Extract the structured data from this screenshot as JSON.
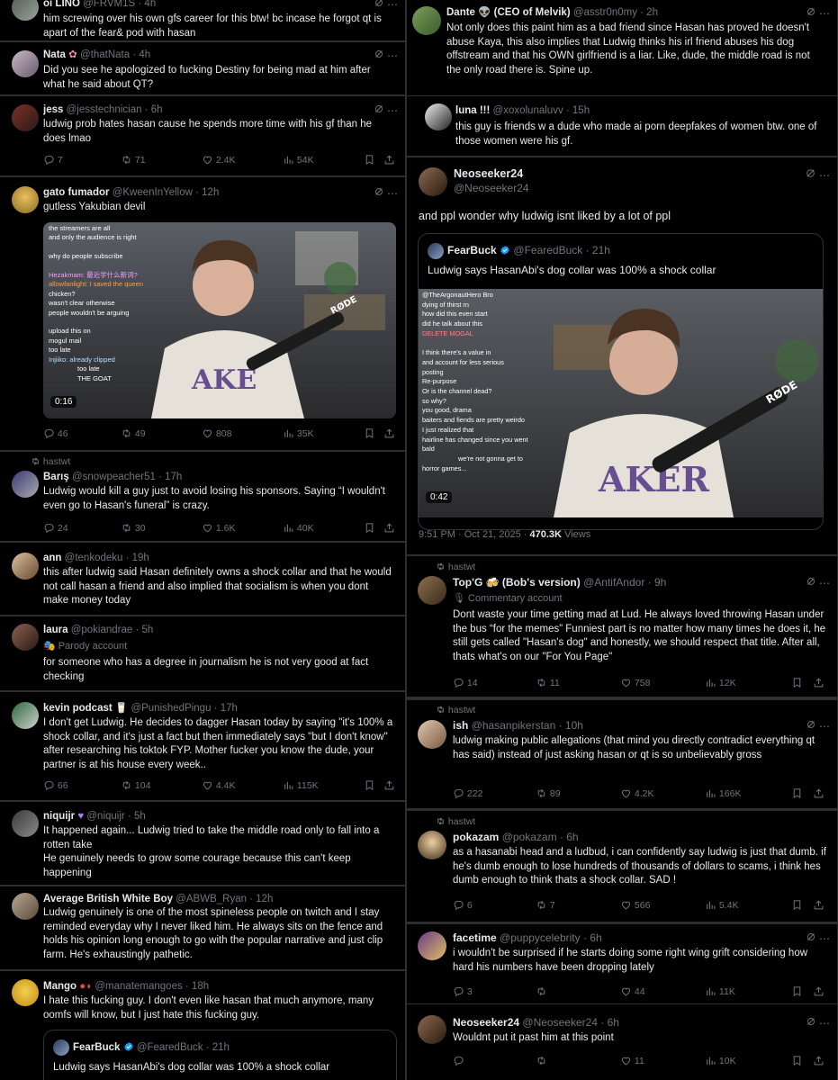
{
  "colors": {
    "accent": "#1d9bf0",
    "verified_gold": "#e2b719",
    "muted": "#71767b"
  },
  "left": {
    "p1": {
      "name": "oi LINO",
      "handle": "@FRVM1S · 4h",
      "body": "him screwing over his own gfs career for this btw! bc incase he forgot qt is apart of the fear& pod with hasan"
    },
    "p2": {
      "name": "Nata",
      "handle": "@thatNata · 4h",
      "body": "Did you see he apologized to fucking Destiny for being mad at him after what he said about QT?"
    },
    "p3": {
      "name": "jess",
      "handle": "@jesstechnician · 6h",
      "body": "ludwig prob hates hasan cause he spends more time with his gf than he does lmao",
      "replies": "7",
      "reposts": "71",
      "likes": "2.4K",
      "views": "54K"
    },
    "p4": {
      "name": "gato fumador",
      "handle": "@KweenInYellow · 12h",
      "body": "gutless Yakubian devil",
      "duration": "0:16",
      "chat": [
        "the streamers are all",
        "and only the audience is right",
        "why do people subscribe",
        "Hezakmam: 最近学什么新词?",
        "allowfanlight: I saved the queen",
        "chicken?",
        "wasn't clear otherwise",
        "people wouldn't be arguing",
        "upload this on",
        "mogul mail",
        "too late",
        "Injiiko: already clipped",
        "too late",
        "THE GOAT"
      ],
      "replies": "46",
      "reposts": "49",
      "likes": "808",
      "views": "35K"
    },
    "p5": {
      "repost_by": "hastwt",
      "name": "Barış",
      "handle": "@snowpeacher51 · 17h",
      "body": "Ludwig would kill a guy just to avoid losing his sponsors. Saying “I wouldn't even go to Hasan's funeral” is crazy.",
      "replies": "24",
      "reposts": "30",
      "likes": "1.6K",
      "views": "40K"
    },
    "p6": {
      "name": "ann",
      "handle": "@tenkodeku · 19h",
      "body": "this after ludwig said Hasan definitely owns a shock collar and that he would not call hasan a friend and also implied that socialism is when you dont make money today"
    },
    "p7": {
      "name": "laura",
      "handle": "@pokiandrae · 5h",
      "label": "Parody account",
      "body": "for someone who has a degree in journalism he is not very good at fact checking"
    },
    "p8": {
      "name": "kevin podcast",
      "handle": "@PunishedPingu · 17h",
      "body": "I don't get Ludwig. He decides to dagger Hasan today by saying \"it's 100% a shock collar, and it's just a fact but then immediately says \"but I don't know\" after researching his toktok FYP. Mother fucker you know the dude, your partner is at his house every week..",
      "replies": "66",
      "reposts": "104",
      "likes": "4.4K",
      "views": "115K"
    },
    "p9": {
      "name": "niquijr",
      "handle": "@niquijr · 5h",
      "body": "It happened again... Ludwig tried to take the middle road only to fall into a rotten take\nHe genuinely needs to grow some courage because this can't keep happening"
    },
    "p10": {
      "name": "Average British White Boy",
      "handle": "@ABWB_Ryan · 12h",
      "body": "Ludwig genuinely is one of the most spineless people on twitch and I stay reminded everyday why I never liked him. He always sits on the fence and holds his opinion long enough to go with the popular narrative and just clip farm. He's exhaustingly pathetic."
    },
    "p11": {
      "name": "Mango",
      "handle": "@manatemangoes · 18h",
      "body": "I hate this fucking guy. I don't even like hasan that much anymore, many oomfs will know, but I just hate this fucking guy.",
      "quote": {
        "name": "FearBuck",
        "handle": "@FearedBuck · 21h",
        "body": "Ludwig says HasanAbi's dog collar was 100% a shock collar"
      }
    }
  },
  "right": {
    "p1": {
      "name": "Dante 👽 (CEO of Melvik)",
      "handle": "@asstr0n0my · 2h",
      "body": "Not only does this paint him as a bad friend since Hasan has proved he doesn't abuse Kaya, this also implies that Ludwig thinks his irl friend abuses his dog offstream and that his OWN girlfriend is a liar. Like, dude, the middle road is not the only road there is. Spine up."
    },
    "p2": {
      "name": "luna !!!",
      "handle": "@xoxolunaluvv · 15h",
      "body": "this guy is friends w a dude who made ai porn deepfakes of women btw. one of those women were his gf."
    },
    "p3": {
      "name": "Neoseeker24",
      "handle": "@Neoseeker24",
      "body": "and ppl wonder why ludwig isnt liked by a lot of ppl",
      "quote": {
        "name": "FearBuck",
        "handle": "@FearedBuck · 21h",
        "body": "Ludwig says HasanAbi's dog collar was 100% a shock collar"
      },
      "duration": "0:42",
      "chat": [
        "@TheArgonautHero Bro",
        "dying of thirst rn",
        "how did this even start",
        "did he talk about this",
        "DELETE MOGAL",
        "I think there's a value in",
        "and account for less serious",
        "posting",
        "Re-purpose",
        "Or is the channel dead?",
        "so why?",
        "you good, drama",
        "baiters and fiends are pretty weirdo",
        "I just realized that ",
        "hairline has changed since you went",
        "bald",
        "we're not gonna get to",
        "horror games..."
      ],
      "time": "9:51 PM · Oct 21, 2025 ·",
      "views_count": "470.3K",
      "views_label": "Views"
    },
    "p4": {
      "repost_by": "hastwt",
      "name": "Top'G 🍻 (Bob's version)",
      "handle": "@AntifAndor · 9h",
      "label": "Commentary account",
      "body": "Dont waste your time getting mad at Lud. He always loved throwing Hasan under the bus “for the memes” Funniest part is no matter how many times he does it, he still gets called \"Hasan's dog\" and honestly, we should respect that title. After all, thats what's on our \"For You Page\"",
      "replies": "14",
      "reposts": "11",
      "likes": "758",
      "views": "12K"
    },
    "p5": {
      "repost_by": "hastwt",
      "name": "ish",
      "handle": "@hasanpikerstan · 10h",
      "body": "ludwig making public allegations (that mind you directly contradict everything qt has said) instead of just asking hasan or qt is so unbelievably gross",
      "replies": "222",
      "reposts": "89",
      "likes": "4.2K",
      "views": "166K"
    },
    "p6": {
      "repost_by": "hastwt",
      "name": "pokazam",
      "handle": "@pokazam · 6h",
      "body": "as a hasanabi head and a ludbud, i can confidently say ludwig is just that dumb. if he's dumb enough to lose hundreds of thousands of dollars to scams, i think hes dumb enough to think thats a shock collar. SAD !",
      "replies": "6",
      "reposts": "7",
      "likes": "566",
      "views": "5.4K"
    },
    "p7": {
      "name": "facetime",
      "handle": "@puppycelebrity · 6h",
      "body": "i wouldn't be surprised if he starts doing some right wing grift considering how hard his numbers have been dropping lately",
      "replies": "3",
      "reposts": "",
      "likes": "44",
      "views": "11K"
    },
    "p8": {
      "name": "Neoseeker24",
      "handle": "@Neoseeker24 · 6h",
      "body": "Wouldnt put it past him at this point",
      "replies": "",
      "reposts": "",
      "likes": "11",
      "views": "10K"
    }
  }
}
